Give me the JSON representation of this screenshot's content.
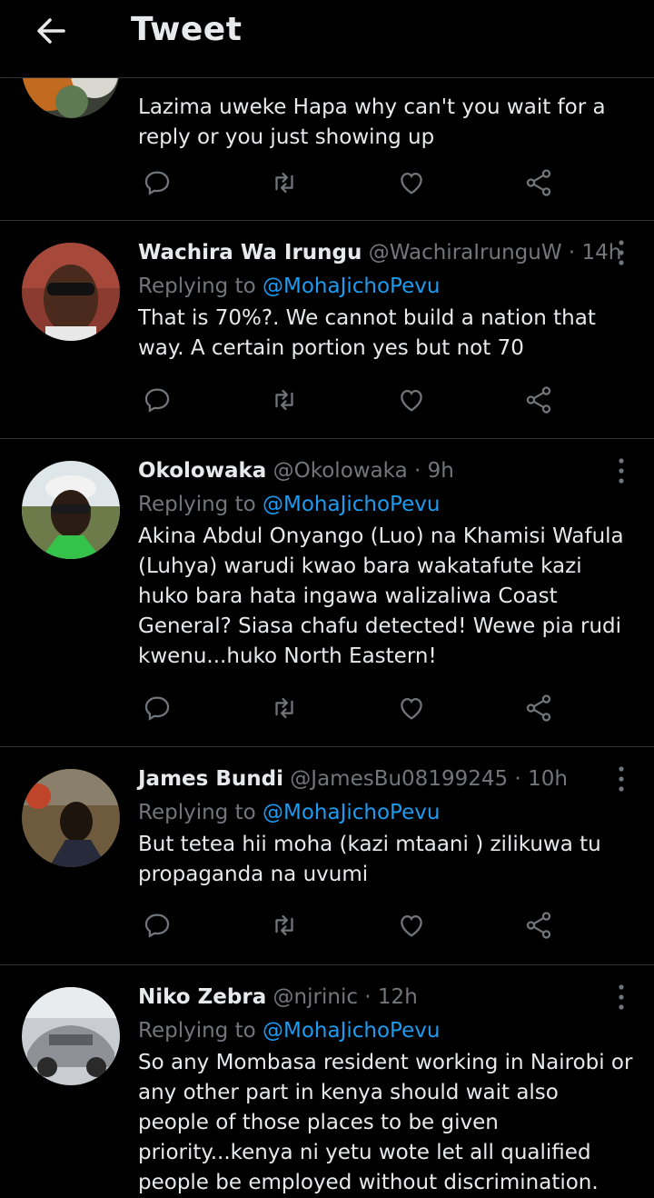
{
  "header": {
    "title": "Tweet"
  },
  "tweets": [
    {
      "text": "Lazima uweke Hapa why can't you wait for a reply or you just showing up"
    },
    {
      "name": "Wachira Wa Irungu",
      "handle": "@WachiraIrunguW",
      "dot": " · ",
      "time": "14h",
      "replying_prefix": "Replying to ",
      "mention": "@MohaJichoPevu",
      "text": "That is 70%?. We cannot build a nation that way. A certain portion yes but not 70"
    },
    {
      "name": "Okolowaka",
      "handle": "@Okolowaka",
      "dot": " · ",
      "time": "9h",
      "replying_prefix": "Replying to ",
      "mention": "@MohaJichoPevu",
      "text": "Akina Abdul Onyango (Luo) na Khamisi  Wafula (Luhya) warudi kwao bara wakatafute kazi huko bara hata ingawa walizaliwa Coast General? Siasa chafu detected! Wewe pia rudi kwenu...huko North Eastern!"
    },
    {
      "name": "James Bundi",
      "handle": "@JamesBu08199245",
      "dot": " · ",
      "time": "10h",
      "replying_prefix": "Replying to ",
      "mention": "@MohaJichoPevu",
      "text": "But tetea hii moha (kazi mtaani ) zilikuwa tu propaganda na uvumi"
    },
    {
      "name": "Niko Zebra",
      "handle": "@njrinic",
      "dot": " · ",
      "time": "12h",
      "replying_prefix": "Replying to ",
      "mention": "@MohaJichoPevu",
      "text": "So any Mombasa resident working in Nairobi or any other part in kenya should wait also people of those places to be given priority...kenya ni yetu wote let all qualified people be employed without discrimination."
    }
  ],
  "icons": {
    "back": "arrow-left-icon",
    "reply": "reply-icon",
    "retweet": "retweet-icon",
    "like": "heart-icon",
    "share": "share-icon",
    "more": "more-vertical-icon"
  },
  "colors": {
    "background": "#000000",
    "text": "#e7e9ea",
    "secondary": "#71767b",
    "link": "#1d9bf0",
    "divider": "#2f3336"
  }
}
